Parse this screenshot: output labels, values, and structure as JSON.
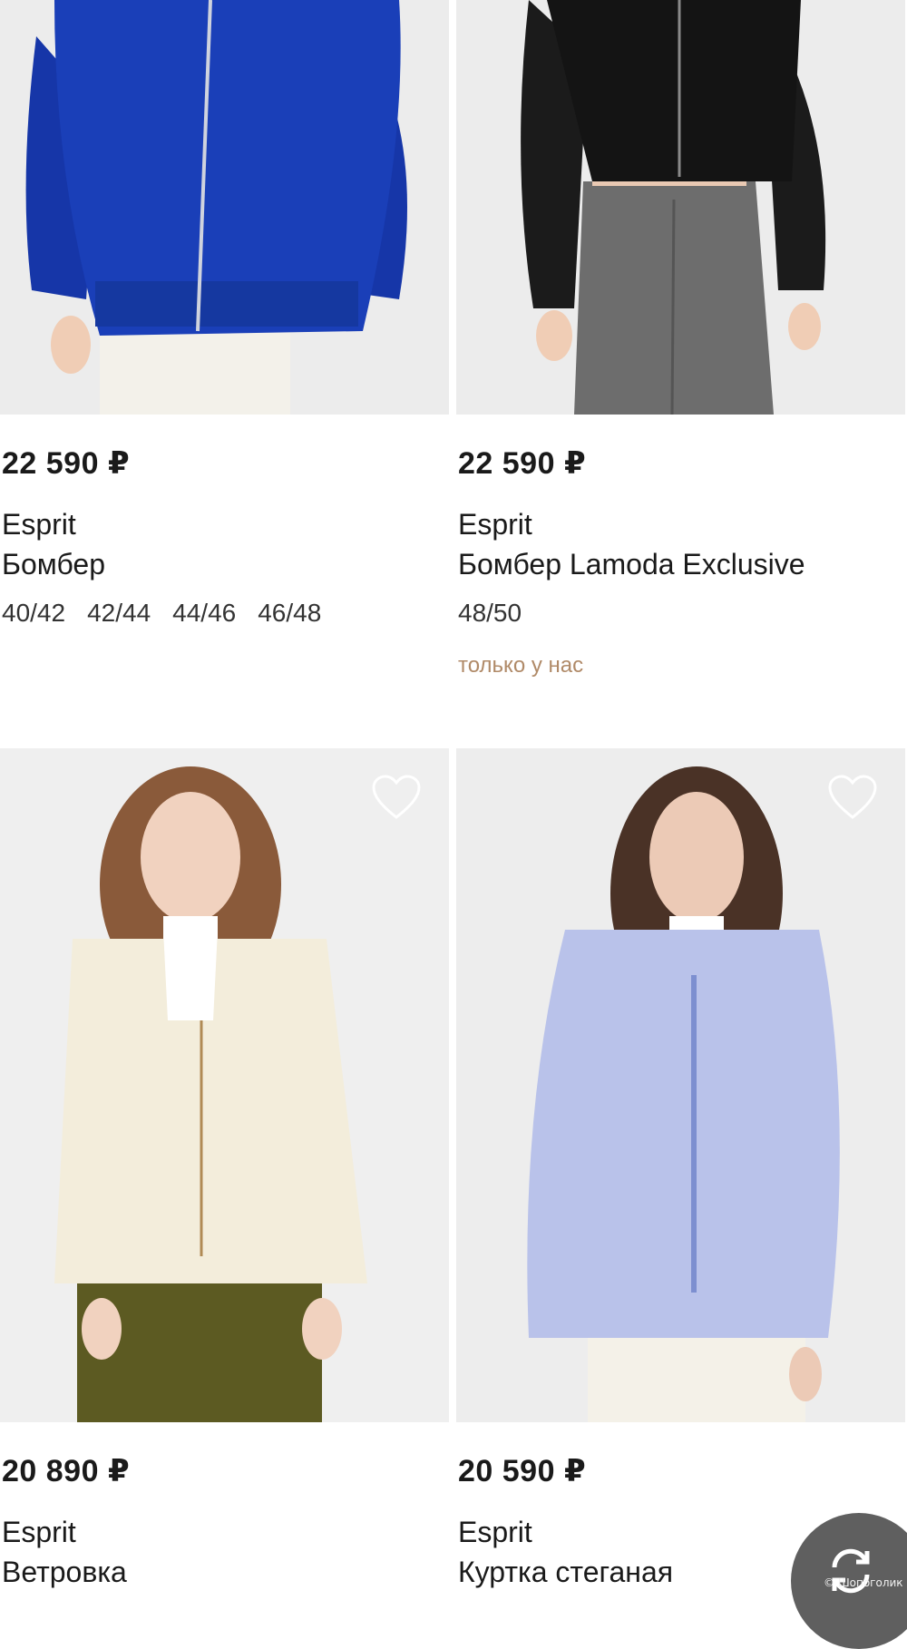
{
  "products": [
    {
      "price": "22 590 ₽",
      "brand": "Esprit",
      "name": "Бомбер",
      "sizes": [
        "40/42",
        "42/44",
        "44/46",
        "46/48"
      ],
      "jacket_color": "#1a3fb8"
    },
    {
      "price": "22 590 ₽",
      "brand": "Esprit",
      "name": "Бомбер Lamoda Exclusive",
      "sizes": [
        "48/50"
      ],
      "tag": "только у нас",
      "jacket_color": "#141414"
    },
    {
      "price": "20 890 ₽",
      "brand": "Esprit",
      "name": "Ветровка",
      "jacket_color": "#f3eddb",
      "favorite_icon": "heart-outline-icon"
    },
    {
      "price": "20 590 ₽",
      "brand": "Esprit",
      "name": "Куртка стеганая",
      "jacket_color": "#b9c2ea",
      "favorite_icon": "heart-outline-icon"
    }
  ],
  "watermark": "© Шопоголик",
  "fab_icon": "refresh-icon"
}
